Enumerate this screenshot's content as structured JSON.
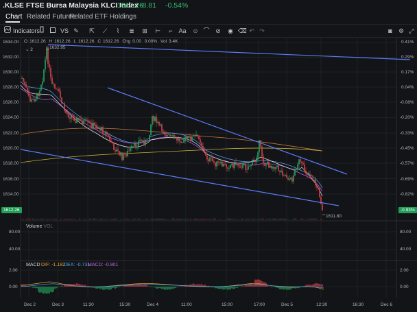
{
  "header": {
    "symbol": ".KLSE FTSE Bursa Malaysia KLCI Index",
    "price": "1612.26",
    "change": "-8.81",
    "change_pct": "-0.54%",
    "up_color": "#2fbf71"
  },
  "tabs": [
    {
      "label": "Chart",
      "active": true
    },
    {
      "label": "Related Futures",
      "active": false
    },
    {
      "label": "Related ETF Holdings",
      "active": false
    }
  ],
  "toolbar": {
    "indicators_label": "Indicators",
    "vs_label": "VS",
    "text_tool_label": "Aa"
  },
  "ohlc": {
    "open_label": "O",
    "open": "1612.26",
    "high_label": "H",
    "high": "1612.26",
    "low_label": "L",
    "low": "1612.26",
    "close_label": "C",
    "close": "1612.26",
    "chg_label": "Chg",
    "chg": "0.00",
    "chg_pct": "0.00%",
    "vol_label": "Vol",
    "vol": "3.4K"
  },
  "price_axis_left": [
    "1634.00",
    "1632.00",
    "1630.00",
    "1628.00",
    "1626.00",
    "1624.00",
    "1622.00",
    "1620.00",
    "1618.00",
    "1616.00",
    "1614.00"
  ],
  "price_axis_right": [
    "0.41%",
    "0.29%",
    "0.17%",
    "0.04%",
    "-0.08%",
    "-0.20%",
    "-0.33%",
    "-0.45%",
    "-0.57%",
    "-0.69%",
    "-0.82%"
  ],
  "last_price_badge": "1612.26",
  "last_pct_badge": "-0.93%",
  "high_marker": "1632.95",
  "low_marker": "1611.80",
  "collapse_count": "2",
  "volume": {
    "title": "Volume",
    "sub": "VOL",
    "ticks": [
      "80.00",
      "40.00"
    ]
  },
  "macd": {
    "title": "MACD",
    "dif": "DIF: -1.182",
    "dea": "DEA: -0.731",
    "macd": "MACD: -0.901",
    "ticks": [
      "2.00",
      "0.00"
    ]
  },
  "date_axis": [
    "Dec 2",
    "Dec 3",
    "11:30",
    "15:30",
    "Dec 4",
    "11:00",
    "15:00",
    "17:00",
    "Dec 5",
    "12:30",
    "16:30",
    "Dec 6"
  ],
  "colors": {
    "bull": "#22a860",
    "bear": "#d9424a",
    "trendline": "#5b7cfa",
    "ma_yellow": "#c9b23a",
    "ma_orange": "#c97a3a",
    "ma_purple": "#b05ad8",
    "ma_blue": "#4aa0e8",
    "ma_white": "#d8d8d8"
  },
  "chart_data": {
    "type": "candlestick",
    "y_range": [
      1612,
      1634
    ],
    "x_ticks": [
      "Dec 2",
      "Dec 3",
      "11:30",
      "15:30",
      "Dec 4",
      "11:00",
      "15:00",
      "17:00",
      "Dec 5",
      "12:30",
      "16:30",
      "Dec 6"
    ],
    "notable": {
      "high": 1632.95,
      "low": 1611.8,
      "last": 1612.26
    }
  }
}
